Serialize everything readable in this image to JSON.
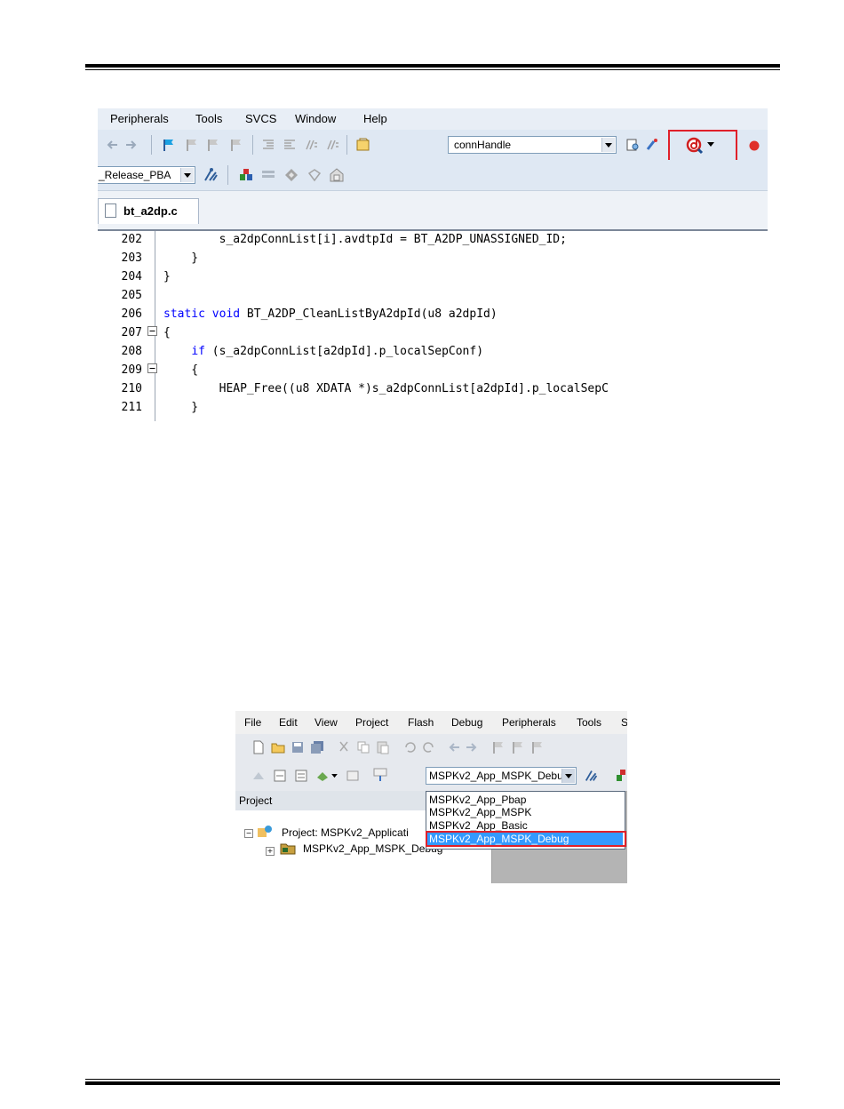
{
  "screenshot1": {
    "menu": [
      "Peripherals",
      "Tools",
      "SVCS",
      "Window",
      "Help"
    ],
    "find_combo": {
      "value": "connHandle"
    },
    "target_combo": {
      "value": "_Release_PBA"
    },
    "tab": {
      "label": "bt_a2dp.c"
    },
    "code_lines": [
      {
        "num": "202",
        "pre": "        s_a2dpConnList[i].avdtpId = BT_A2DP_UNASSIGNED_ID;",
        "kw": "",
        "post": ""
      },
      {
        "num": "203",
        "pre": "    }",
        "kw": "",
        "post": ""
      },
      {
        "num": "204",
        "pre": "}",
        "kw": "",
        "post": ""
      },
      {
        "num": "205",
        "pre": "",
        "kw": "",
        "post": ""
      },
      {
        "num": "206",
        "pre": "",
        "kw": "static void",
        "post": " BT_A2DP_CleanListByA2dpId(u8 a2dpId)"
      },
      {
        "num": "207",
        "pre": "{",
        "kw": "",
        "post": ""
      },
      {
        "num": "208",
        "pre": "    ",
        "kw": "if",
        "post": " (s_a2dpConnList[a2dpId].p_localSepConf)"
      },
      {
        "num": "209",
        "pre": "    {",
        "kw": "",
        "post": ""
      },
      {
        "num": "210",
        "pre": "        HEAP_Free((u8 XDATA *)s_a2dpConnList[a2dpId].p_localSepC",
        "kw": "",
        "post": ""
      },
      {
        "num": "211",
        "pre": "    }",
        "kw": "",
        "post": ""
      }
    ],
    "highlight_color": "#e0202a"
  },
  "screenshot2": {
    "menu": [
      "File",
      "Edit",
      "View",
      "Project",
      "Flash",
      "Debug",
      "Peripherals",
      "Tools",
      "S"
    ],
    "target_combo": {
      "value": "MSPKv2_App_MSPK_Debu"
    },
    "project_panel_title": "Project",
    "tree": {
      "root": "Project: MSPKv2_Applicati",
      "child": "MSPKv2_App_MSPK_Debug"
    },
    "dropdown_options": [
      "MSPKv2_App_Pbap",
      "MSPKv2_App_MSPK",
      "MSPKv2_App_Basic",
      "MSPKv2_App_MSPK_Debug"
    ],
    "selected_option": "MSPKv2_App_MSPK_Debug"
  }
}
